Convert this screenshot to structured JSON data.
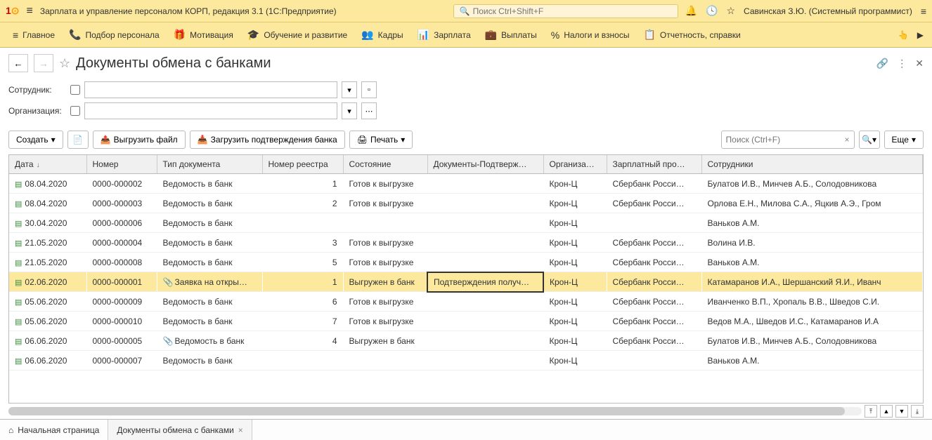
{
  "topbar": {
    "app_title": "Зарплата и управление персоналом КОРП, редакция 3.1  (1С:Предприятие)",
    "search_placeholder": "Поиск Ctrl+Shift+F",
    "user": "Савинская З.Ю. (Системный программист)"
  },
  "nav": [
    {
      "icon": "≡",
      "label": "Главное"
    },
    {
      "icon": "📞",
      "label": "Подбор персонала"
    },
    {
      "icon": "🎁",
      "label": "Мотивация"
    },
    {
      "icon": "🎓",
      "label": "Обучение и развитие"
    },
    {
      "icon": "👥",
      "label": "Кадры"
    },
    {
      "icon": "📊",
      "label": "Зарплата"
    },
    {
      "icon": "💼",
      "label": "Выплаты"
    },
    {
      "icon": "%",
      "label": "Налоги и взносы"
    },
    {
      "icon": "📋",
      "label": "Отчетность, справки"
    }
  ],
  "page": {
    "title": "Документы обмена с банками"
  },
  "filters": {
    "employee_label": "Сотрудник:",
    "org_label": "Организация:"
  },
  "toolbar": {
    "create": "Создать",
    "export": "Выгрузить файл",
    "import": "Загрузить подтверждения банка",
    "print": "Печать",
    "search_placeholder": "Поиск (Ctrl+F)",
    "more": "Еще"
  },
  "columns": [
    "Дата",
    "Номер",
    "Тип документа",
    "Номер реестра",
    "Состояние",
    "Документы-Подтверж…",
    "Организа…",
    "Зарплатный про…",
    "Сотрудники"
  ],
  "rows": [
    {
      "clip": false,
      "date": "08.04.2020",
      "num": "0000-000002",
      "type": "Ведомость в банк",
      "reg": "1",
      "state": "Готов к выгрузке",
      "docs": "",
      "org": "Крон-Ц",
      "proj": "Сбербанк Росси…",
      "emp": "Булатов И.В., Минчев А.Б., Солодовникова"
    },
    {
      "clip": false,
      "date": "08.04.2020",
      "num": "0000-000003",
      "type": "Ведомость в банк",
      "reg": "2",
      "state": "Готов к выгрузке",
      "docs": "",
      "org": "Крон-Ц",
      "proj": "Сбербанк Росси…",
      "emp": "Орлова Е.Н., Милова С.А., Яцкив А.Э., Гром"
    },
    {
      "clip": false,
      "date": "30.04.2020",
      "num": "0000-000006",
      "type": "Ведомость в банк",
      "reg": "",
      "state": "",
      "docs": "",
      "org": "Крон-Ц",
      "proj": "",
      "emp": "Ваньков А.М."
    },
    {
      "clip": false,
      "date": "21.05.2020",
      "num": "0000-000004",
      "type": "Ведомость в банк",
      "reg": "3",
      "state": "Готов к выгрузке",
      "docs": "",
      "org": "Крон-Ц",
      "proj": "Сбербанк Росси…",
      "emp": "Волина И.В."
    },
    {
      "clip": false,
      "date": "21.05.2020",
      "num": "0000-000008",
      "type": "Ведомость в банк",
      "reg": "5",
      "state": "Готов к выгрузке",
      "docs": "",
      "org": "Крон-Ц",
      "proj": "Сбербанк Росси…",
      "emp": "Ваньков А.М."
    },
    {
      "clip": true,
      "selected": true,
      "date": "02.06.2020",
      "num": "0000-000001",
      "type": "Заявка на откры…",
      "reg": "1",
      "state": "Выгружен в банк",
      "docs": "Подтверждения получ…",
      "org": "Крон-Ц",
      "proj": "Сбербанк Росси…",
      "emp": "Катамаранов И.А., Шершанский Я.И., Иванч"
    },
    {
      "clip": false,
      "date": "05.06.2020",
      "num": "0000-000009",
      "type": "Ведомость в банк",
      "reg": "6",
      "state": "Готов к выгрузке",
      "docs": "",
      "org": "Крон-Ц",
      "proj": "Сбербанк Росси…",
      "emp": "Иванченко В.П., Хропаль В.В., Шведов С.И."
    },
    {
      "clip": false,
      "date": "05.06.2020",
      "num": "0000-000010",
      "type": "Ведомость в банк",
      "reg": "7",
      "state": "Готов к выгрузке",
      "docs": "",
      "org": "Крон-Ц",
      "proj": "Сбербанк Росси…",
      "emp": "Ведов М.А., Шведов И.С., Катамаранов И.А"
    },
    {
      "clip": true,
      "date": "06.06.2020",
      "num": "0000-000005",
      "type": "Ведомость в банк",
      "reg": "4",
      "state": "Выгружен в банк",
      "docs": "",
      "org": "Крон-Ц",
      "proj": "Сбербанк Росси…",
      "emp": "Булатов И.В., Минчев А.Б., Солодовникова"
    },
    {
      "clip": false,
      "date": "06.06.2020",
      "num": "0000-000007",
      "type": "Ведомость в банк",
      "reg": "",
      "state": "",
      "docs": "",
      "org": "Крон-Ц",
      "proj": "",
      "emp": "Ваньков А.М."
    }
  ],
  "tabs": [
    {
      "icon": "⌂",
      "label": "Начальная страница",
      "closable": false
    },
    {
      "icon": "",
      "label": "Документы обмена с банками",
      "closable": true,
      "active": true
    }
  ]
}
